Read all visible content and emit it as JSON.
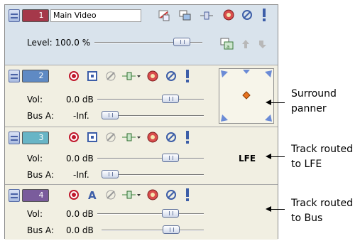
{
  "colors": {
    "main_track_bg": "#d9e3ec",
    "track_bg": "#f1efe2",
    "track1_color": "#a5384a",
    "track2_color": "#5f8ac4",
    "track3_color": "#68b5c6",
    "track4_color": "#7a5c9c"
  },
  "main_track": {
    "number": "1",
    "name": "Main Video",
    "level_label": "Level: 100.0 %",
    "level_fraction": 0.85,
    "icons": [
      "track-fx-icon",
      "compositing-mode-icon",
      "make-parent-icon",
      "fx-gear-icon",
      "mute-icon",
      "solo-icon",
      "compositing-child-icon",
      "parent-motion-icon",
      "make-compositing-child-icon"
    ]
  },
  "tracks": [
    {
      "number": "2",
      "vol_label": "Vol:",
      "vol_value": "0.0 dB",
      "vol_fraction": 0.72,
      "bus_label": "Bus A:",
      "bus_value": "-Inf.",
      "bus_fraction": 0.0
    },
    {
      "number": "3",
      "vol_label": "Vol:",
      "vol_value": "0.0 dB",
      "vol_fraction": 0.72,
      "bus_label": "Bus A:",
      "bus_value": "-Inf.",
      "bus_fraction": 0.0,
      "routing_label": "LFE"
    },
    {
      "number": "4",
      "vol_label": "Vol:",
      "vol_value": "0.0 dB",
      "vol_fraction": 0.72,
      "bus_label": "Bus A:",
      "bus_value": "0.0 dB",
      "bus_fraction": 0.72
    }
  ],
  "callouts": {
    "surround": "Surround\npanner",
    "lfe": "Track routed\nto LFE",
    "bus": "Track routed\nto Bus"
  }
}
